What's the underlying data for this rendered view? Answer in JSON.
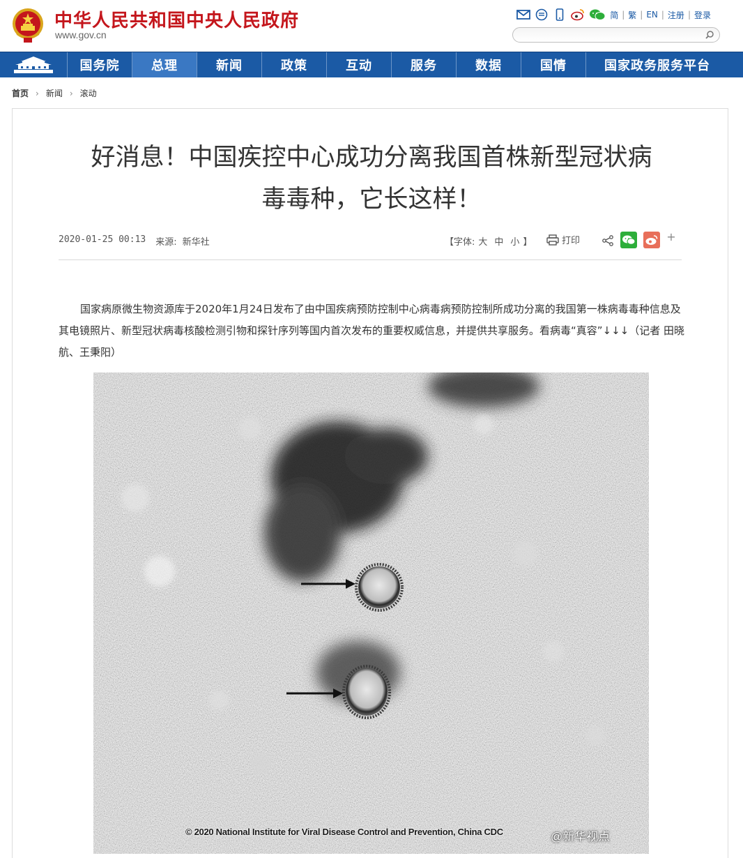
{
  "header": {
    "site_title": "中华人民共和国中央人民政府",
    "site_url": "www.gov.cn",
    "toolbar_links": [
      "简",
      "繁",
      "EN",
      "注册",
      "登录"
    ],
    "toolbar_icons": [
      "mail-icon",
      "message-icon",
      "mobile-icon",
      "weibo-icon",
      "wechat-icon"
    ],
    "search": {
      "placeholder": "",
      "value": ""
    }
  },
  "nav": {
    "items": [
      {
        "label": "国务院",
        "active": false
      },
      {
        "label": "总理",
        "active": true
      },
      {
        "label": "新闻",
        "active": false
      },
      {
        "label": "政策",
        "active": false
      },
      {
        "label": "互动",
        "active": false
      },
      {
        "label": "服务",
        "active": false
      },
      {
        "label": "数据",
        "active": false
      },
      {
        "label": "国情",
        "active": false
      },
      {
        "label": "国家政务服务平台",
        "active": false
      }
    ]
  },
  "breadcrumb": [
    "首页",
    "新闻",
    "滚动"
  ],
  "article": {
    "title_line1": "好消息！中国疾控中心成功分离我国首株新型冠状病",
    "title_line2": "毒毒种，它长这样！",
    "date": "2020-01-25 00:13",
    "source_label": "来源:",
    "source": "新华社",
    "font_size": {
      "open": "【字体:",
      "large": "大",
      "medium": "中",
      "small": "小",
      "close": "】"
    },
    "print_label": "打印",
    "more_label": "+",
    "body": "国家病原微生物资源库于2020年1月24日发布了由中国疾病预防控制中心病毒病预防控制所成功分离的我国第一株病毒毒种信息及其电镜照片、新型冠状病毒核酸检测引物和探针序列等国内首次发布的重要权威信息，并提供共享服务。看病毒“真容”↓↓↓（记者 田晓航、王秉阳）",
    "photo_credit": "© 2020 National Institute for Viral Disease Control and Prevention, China CDC",
    "watermark_at": "@",
    "watermark": "新华视点"
  },
  "colors": {
    "brand_red": "#c4161c",
    "nav_blue": "#1b5aa5",
    "nav_active": "#3a78c3",
    "wechat_green": "#2dae3a",
    "weibo_red": "#e86f5a"
  }
}
